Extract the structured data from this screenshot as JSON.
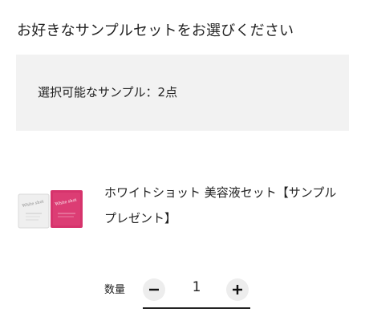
{
  "page": {
    "heading": "お好きなサンプルセットをお選びください"
  },
  "info": {
    "selectable_text": "選択可能なサンプル：2点"
  },
  "product": {
    "image_icon": "sample-sachets-image",
    "name": "ホワイトショット 美容液セット【サンプルプレゼント】",
    "sachet_colors": [
      "#ededed",
      "#d6336c"
    ]
  },
  "quantity": {
    "label": "数量",
    "value": "1",
    "minus_icon": "minus-icon",
    "plus_icon": "plus-icon"
  }
}
